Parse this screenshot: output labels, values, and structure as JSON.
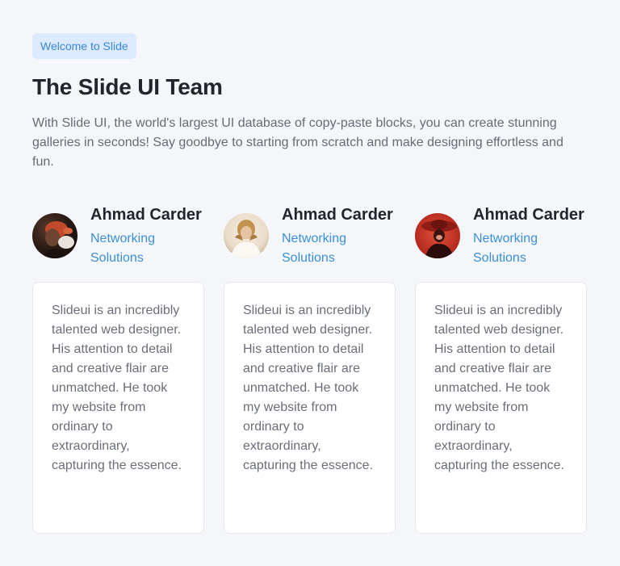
{
  "header": {
    "badge": "Welcome to Slide",
    "title": "The Slide UI Team",
    "description": "With Slide UI, the world's largest UI database of copy-paste blocks, you can create stunning galleries in seconds! Say goodbye to starting from scratch and make designing effortless and fun."
  },
  "colors": {
    "accent": "#3a8fd8",
    "badge_bg": "#dbeafe",
    "page_bg": "#f5f6fa"
  },
  "team": [
    {
      "name": "Ahmad Carder",
      "role": "Networking Solutions",
      "testimonial": "Slideui is an incredibly talented web designer. His attention to detail and creative flair are unmatched. He took my website from ordinary to extraordinary, capturing the essence.",
      "avatar": "avatar-portrait-dark"
    },
    {
      "name": "Ahmad Carder",
      "role": "Networking Solutions",
      "testimonial": "Slideui is an incredibly talented web designer. His attention to detail and creative flair are unmatched. He took my website from ordinary to extraordinary, capturing the essence.",
      "avatar": "avatar-portrait-light"
    },
    {
      "name": "Ahmad Carder",
      "role": "Networking Solutions",
      "testimonial": "Slideui is an incredibly talented web designer. His attention to detail and creative flair are unmatched. He took my website from ordinary to extraordinary, capturing the essence.",
      "avatar": "avatar-portrait-red"
    }
  ]
}
